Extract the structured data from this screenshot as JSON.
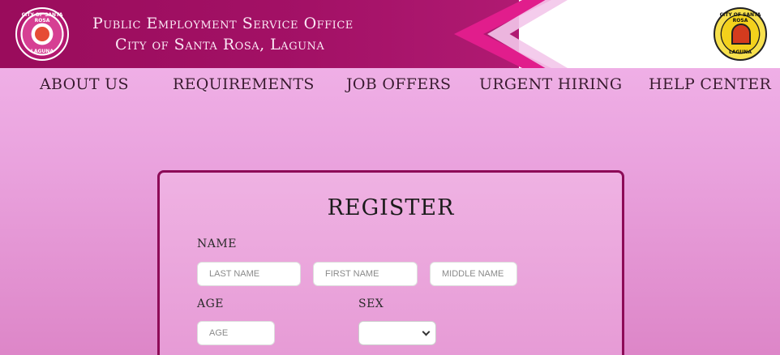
{
  "header": {
    "title_line1": "Public Employment Service Office",
    "title_line2": "City of Santa Rosa, Laguna",
    "logo_left": {
      "top_text": "CITY OF SANTA ROSA",
      "bottom_text": "LAGUNA"
    },
    "logo_right": {
      "top_text": "CITY OF SANTA ROSA",
      "bottom_text": "LAGUNA"
    },
    "colors": {
      "band": "#9a0c5c",
      "accent": "#e11d8c"
    }
  },
  "nav": {
    "items": [
      {
        "label": "ABOUT US"
      },
      {
        "label": "REQUIREMENTS"
      },
      {
        "label": "JOB OFFERS"
      },
      {
        "label": "URGENT HIRING"
      },
      {
        "label": "HELP CENTER"
      }
    ]
  },
  "register": {
    "title": "REGISTER",
    "name_label": "NAME",
    "last_name_placeholder": "LAST NAME",
    "first_name_placeholder": "FIRST NAME",
    "middle_name_placeholder": "MIDDLE NAME",
    "age_label": "AGE",
    "age_placeholder": "AGE",
    "sex_label": "SEX",
    "sex_selected": ""
  }
}
